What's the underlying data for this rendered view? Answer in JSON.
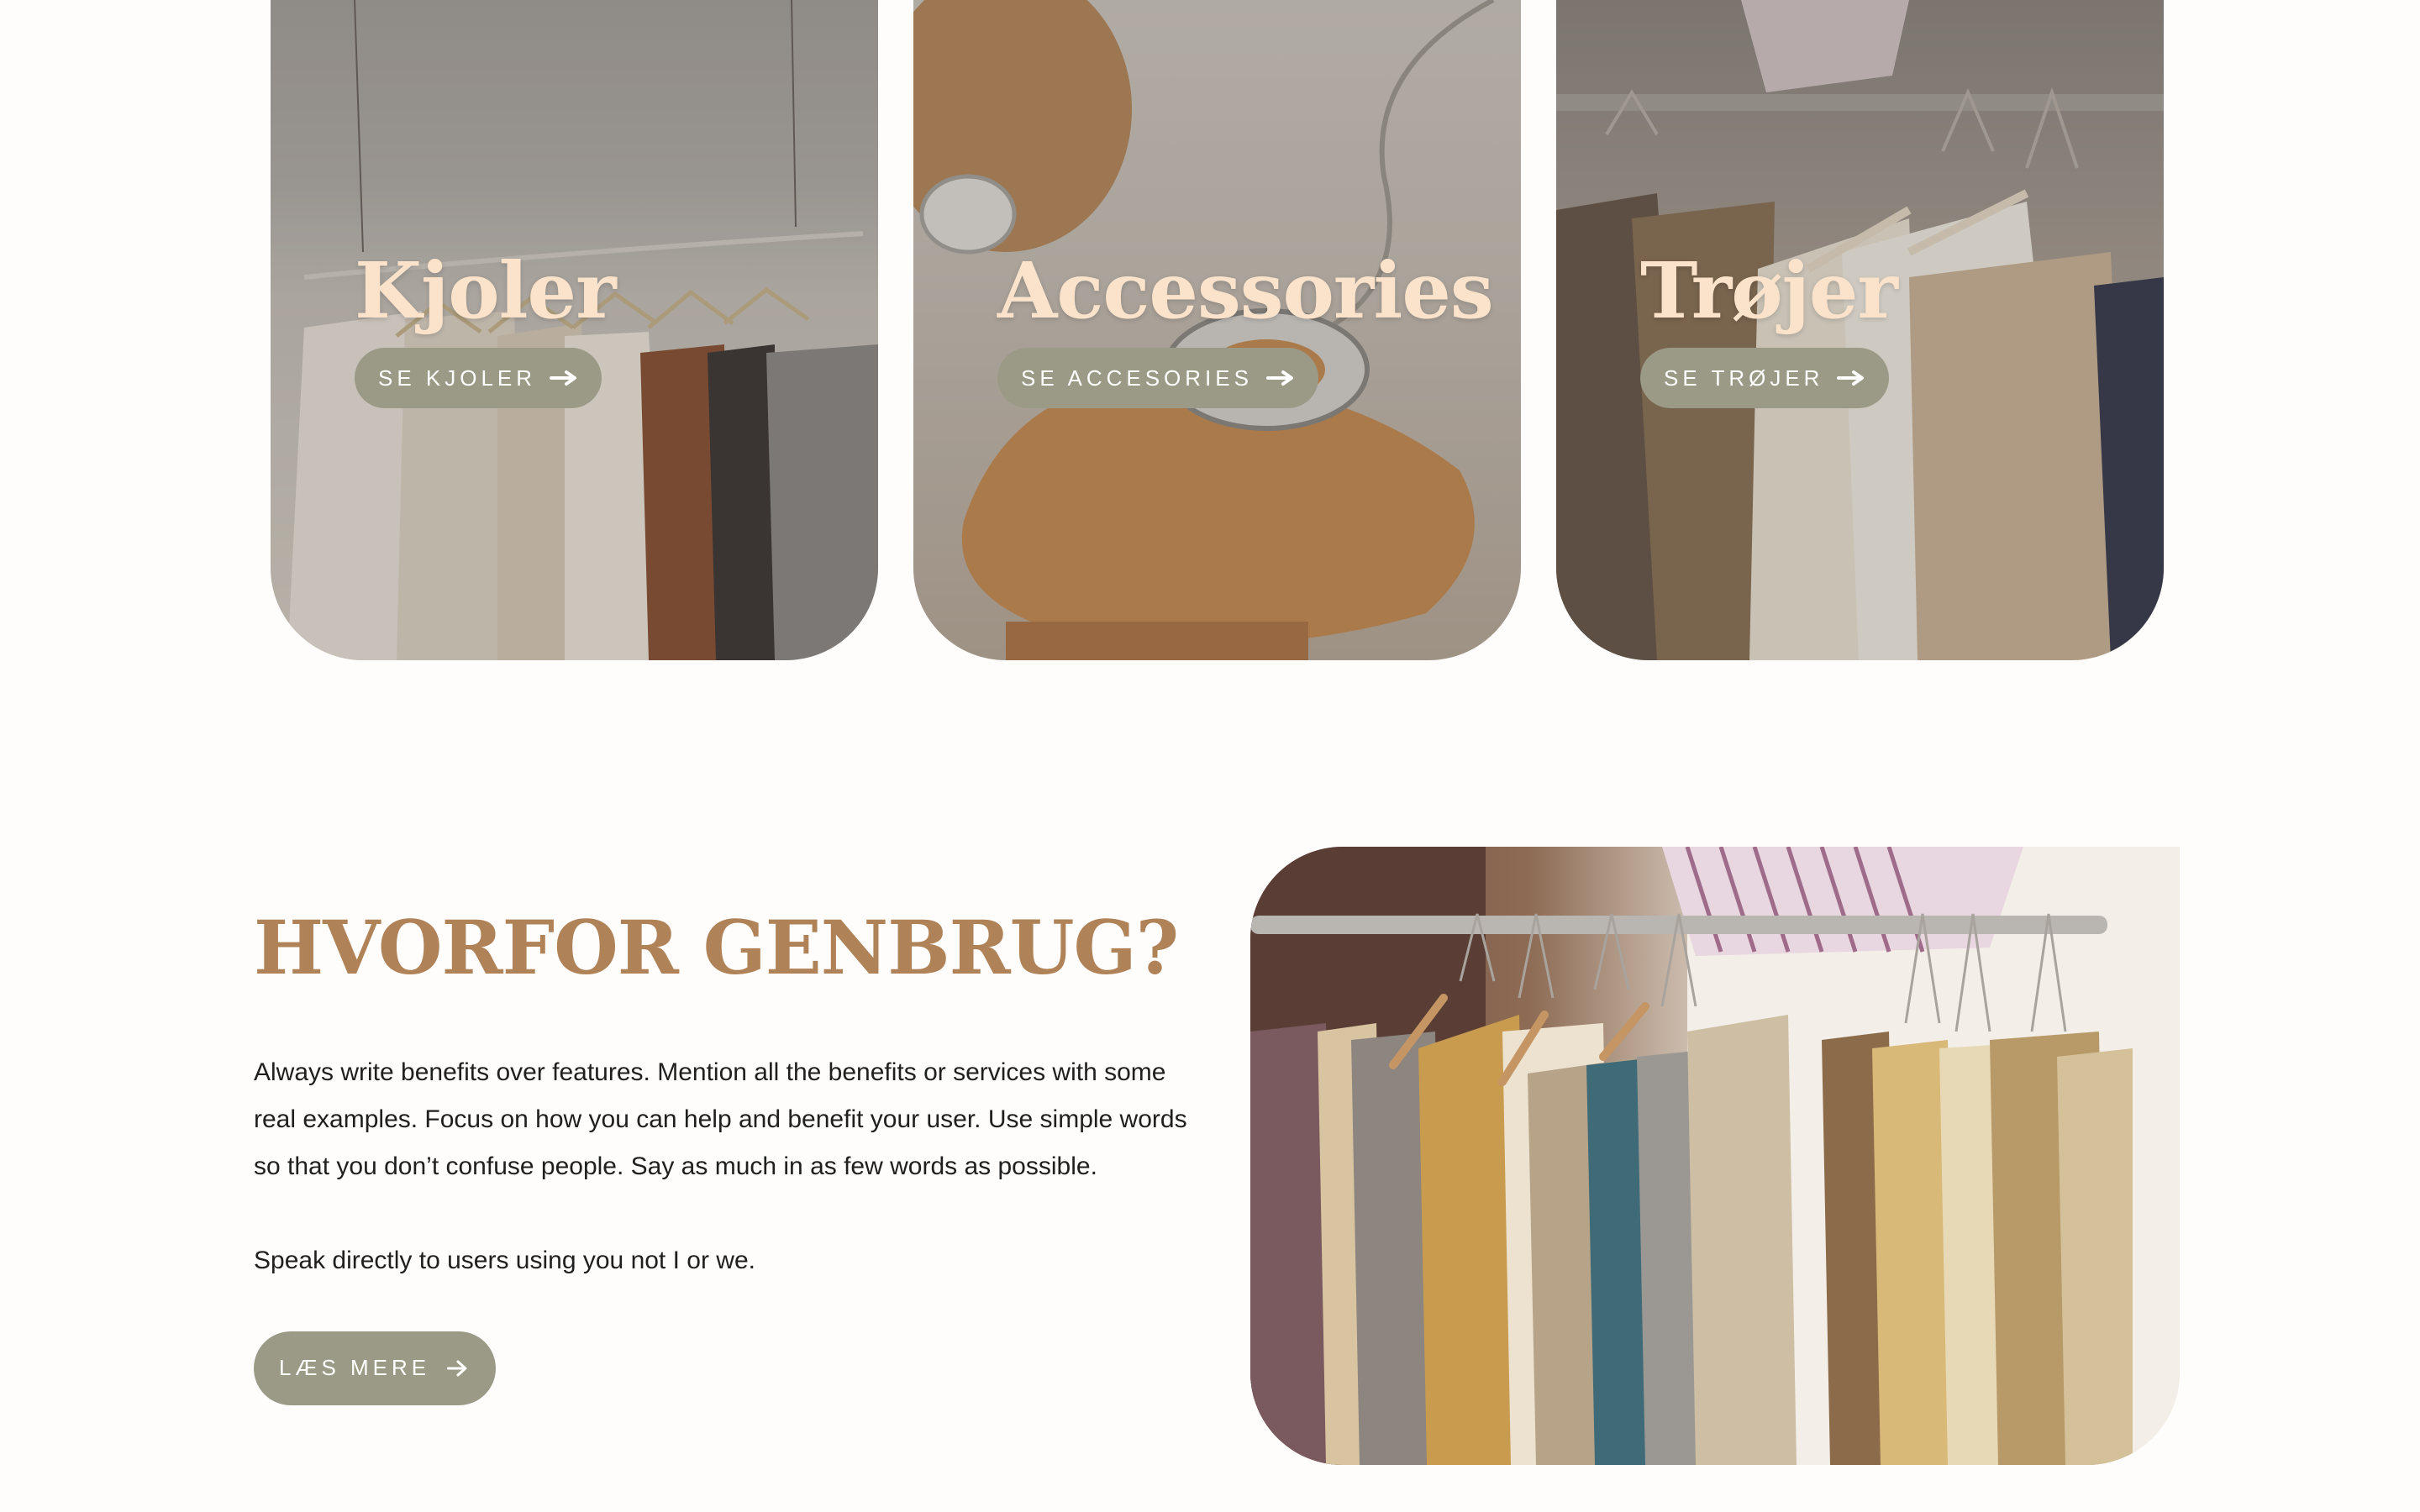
{
  "categories": [
    {
      "title": "Kjoler",
      "button": "SE KJOLER"
    },
    {
      "title": "Accessories",
      "button": "SE ACCESORIES"
    },
    {
      "title": "Trøjer",
      "button": "SE TRØJER"
    }
  ],
  "why": {
    "title": "HVORFOR GENBRUG?",
    "paragraph1": "Always write benefits over features. Mention all the benefits or services with some real examples. Focus on how you can help and benefit your user. Use simple words so that you don’t confuse people. Say as much in as few words as possible.",
    "paragraph2": "Speak directly to users using you not I or we.",
    "button": "LÆS MERE"
  },
  "colors": {
    "accent_brown": "#b08258",
    "button_sage": "#9a9a86",
    "card_title": "#fbe3cb"
  },
  "icons": {
    "button_arrow": "arrow-right-icon"
  }
}
